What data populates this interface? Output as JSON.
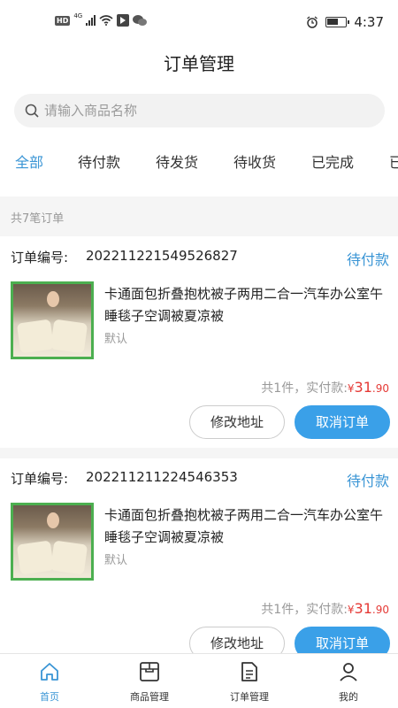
{
  "status_bar": {
    "hd": "HD",
    "network": "4G",
    "time": "4:37"
  },
  "header": {
    "title": "订单管理"
  },
  "search": {
    "placeholder": "请输入商品名称"
  },
  "tabs": [
    {
      "label": "全部",
      "active": true
    },
    {
      "label": "待付款",
      "active": false
    },
    {
      "label": "待发货",
      "active": false
    },
    {
      "label": "待收货",
      "active": false
    },
    {
      "label": "已完成",
      "active": false
    },
    {
      "label": "已",
      "active": false
    }
  ],
  "order_count_text": "共7笔订单",
  "orders": [
    {
      "no_label": "订单编号:",
      "no": "202211221549526827",
      "status": "待付款",
      "title": "卡通面包折叠抱枕被子两用二合一汽车办公室午睡毯子空调被夏凉被",
      "spec": "默认",
      "summary_prefix": "共1件，实付款:",
      "currency": "¥",
      "price_int": "31",
      "price_dec": ".90",
      "btn_edit": "修改地址",
      "btn_cancel": "取消订单"
    },
    {
      "no_label": "订单编号:",
      "no": "202211211224546353",
      "status": "待付款",
      "title": "卡通面包折叠抱枕被子两用二合一汽车办公室午睡毯子空调被夏凉被",
      "spec": "默认",
      "summary_prefix": "共1件，实付款:",
      "currency": "¥",
      "price_int": "31",
      "price_dec": ".90",
      "btn_edit": "修改地址",
      "btn_cancel": "取消订单"
    }
  ],
  "tabbar": [
    {
      "label": "首页",
      "icon": "home-icon",
      "active": true
    },
    {
      "label": "商品管理",
      "icon": "box-icon",
      "active": false
    },
    {
      "label": "订单管理",
      "icon": "document-icon",
      "active": false
    },
    {
      "label": "我的",
      "icon": "user-icon",
      "active": false
    }
  ],
  "colors": {
    "accent": "#3a95d5",
    "button": "#3aa0e8",
    "price": "#e53935"
  }
}
